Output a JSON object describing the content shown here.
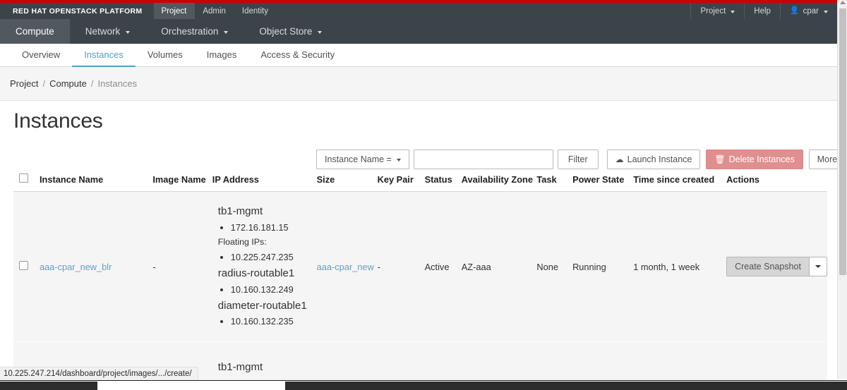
{
  "masthead": {
    "brand": "RED HAT OPENSTACK PLATFORM",
    "tabs": [
      {
        "label": "Project",
        "active": true
      },
      {
        "label": "Admin",
        "active": false
      },
      {
        "label": "Identity",
        "active": false
      }
    ],
    "right": {
      "project_label": "Project",
      "help_label": "Help",
      "user_label": "cpar",
      "user_icon": "user-icon"
    }
  },
  "primary_nav": [
    {
      "label": "Compute",
      "active": true,
      "has_caret": false
    },
    {
      "label": "Network",
      "active": false,
      "has_caret": true
    },
    {
      "label": "Orchestration",
      "active": false,
      "has_caret": true
    },
    {
      "label": "Object Store",
      "active": false,
      "has_caret": true
    }
  ],
  "sub_nav": [
    {
      "label": "Overview",
      "active": false
    },
    {
      "label": "Instances",
      "active": true
    },
    {
      "label": "Volumes",
      "active": false
    },
    {
      "label": "Images",
      "active": false
    },
    {
      "label": "Access & Security",
      "active": false
    }
  ],
  "breadcrumb": {
    "items": [
      "Project",
      "Compute",
      "Instances"
    ],
    "separator": "/"
  },
  "page": {
    "title": "Instances"
  },
  "toolbar": {
    "filter_select_label": "Instance Name =",
    "filter_input_value": "",
    "filter_input_placeholder": "",
    "filter_button": "Filter",
    "launch_button": "Launch Instance",
    "launch_icon": "cloud-upload-icon",
    "delete_button": "Delete Instances",
    "delete_icon": "trash-icon",
    "more_actions_button": "More Actions",
    "delete_button_color": "#e08f8f"
  },
  "table": {
    "columns": [
      "Instance Name",
      "Image Name",
      "IP Address",
      "Size",
      "Key Pair",
      "Status",
      "Availability Zone",
      "Task",
      "Power State",
      "Time since created",
      "Actions"
    ],
    "rows": [
      {
        "instance_name": "aaa-cpar_new_blr",
        "image_name": "-",
        "networks": [
          {
            "name": "tb1-mgmt",
            "ips": [
              "172.16.181.15"
            ],
            "floating_label": "Floating IPs:",
            "floating_ips": [
              "10.225.247.235"
            ]
          },
          {
            "name": "radius-routable1",
            "ips": [
              "10.160.132.249"
            ]
          },
          {
            "name": "diameter-routable1",
            "ips": [
              "10.160.132.235"
            ]
          }
        ],
        "size": "aaa-cpar_new",
        "key_pair": "-",
        "status": "Active",
        "availability_zone": "AZ-aaa",
        "task": "None",
        "power_state": "Running",
        "time_since_created": "1 month, 1 week",
        "action_primary": "Create Snapshot",
        "action_caret_icon": "chevron-down-icon"
      },
      {
        "networks": [
          {
            "name": "tb1-mgmt"
          }
        ]
      }
    ]
  },
  "status_bar": {
    "url": "10.225.247.214/dashboard/project/images/.../create/"
  },
  "scrollbar": {
    "up_arrow_icon": "chevron-up-icon"
  }
}
